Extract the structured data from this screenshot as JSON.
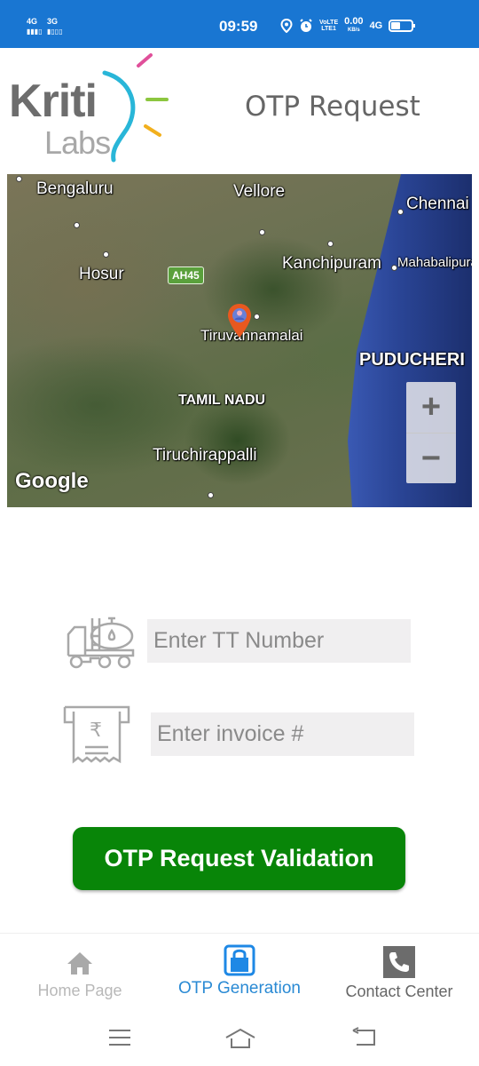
{
  "status_bar": {
    "sim1": "4G",
    "sim2": "3G",
    "time": "09:59",
    "volte_line1": "VoLTE",
    "volte_line2": "LTE1",
    "speed_value": "0.00",
    "speed_unit": "KB/s",
    "network": "4G",
    "icons": [
      "location-icon",
      "alarm-icon",
      "battery-icon"
    ]
  },
  "header": {
    "logo_top": "Kriti",
    "logo_bottom": "Labs",
    "title": "OTP Request"
  },
  "map": {
    "labels": {
      "bengaluru": "Bengaluru",
      "vellore": "Vellore",
      "chennai": "Chennai",
      "hosur": "Hosur",
      "kanchipuram": "Kanchipuram",
      "mahabalipuram": "Mahabalipura",
      "tiruvannamalai": "Tiruvannamalai",
      "puducherry": "PUDUCHERI",
      "tamil_nadu": "TAMIL NADU",
      "tiruchirappalli": "Tiruchirappalli"
    },
    "highway": "AH45",
    "attribution": "Google",
    "zoom_in": "+",
    "zoom_out": "−"
  },
  "form": {
    "tt_number": {
      "placeholder": "Enter TT Number",
      "value": ""
    },
    "invoice": {
      "placeholder": "Enter invoice #",
      "value": ""
    },
    "submit_label": "OTP Request Validation"
  },
  "bottom_nav": {
    "items": [
      {
        "label": "Home Page",
        "icon": "home-icon",
        "active": false
      },
      {
        "label": "OTP Generation",
        "icon": "lock-icon",
        "active": true
      },
      {
        "label": "Contact Center",
        "icon": "phone-icon",
        "active": false
      }
    ]
  },
  "colors": {
    "status_bar": "#1976d2",
    "primary_button": "#088508",
    "active_tab": "#2a8ad4",
    "inactive_tab": "#b0b0b0"
  }
}
